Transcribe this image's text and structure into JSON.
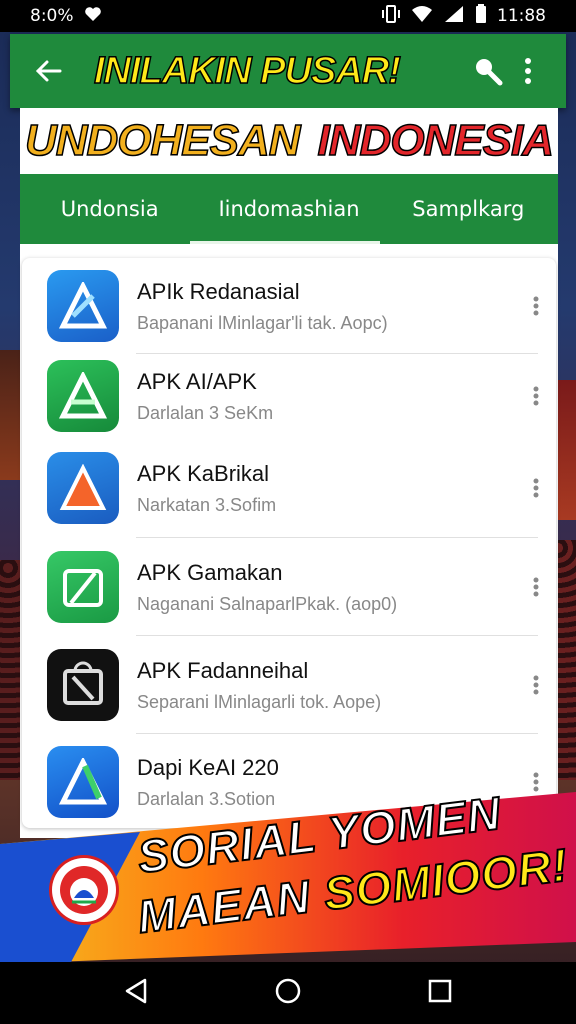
{
  "status_bar": {
    "time_left": "8:0%",
    "time_right": "11:88"
  },
  "app_bar": {
    "title": "INILAKIN PUSAR!"
  },
  "banner": {
    "word1": "UNDOHESAN",
    "word2": "INDONESIA"
  },
  "tabs": [
    {
      "label": "Undonsia"
    },
    {
      "label": "Iindomashian"
    },
    {
      "label": "Samplkarg"
    }
  ],
  "apps": [
    {
      "name": "APIk Redanasial",
      "subtitle": "Bapanani lMinlagar'li tak. Aopc)",
      "icon": "store-a-icon",
      "color": "#1e7be0"
    },
    {
      "name": "APK AI/APK",
      "subtitle": "Darlalan 3 SeKm",
      "icon": "store-a-icon",
      "color": "#1fa84a"
    },
    {
      "name": "APK KaBrikal",
      "subtitle": "Narkatan 3.Sofim",
      "icon": "store-a-icon",
      "color": "#1a78d6"
    },
    {
      "name": "APK Gamakan",
      "subtitle": "Naganani SalnaparlPkak. (aop0)",
      "icon": "store-a-icon",
      "color": "#22b04e"
    },
    {
      "name": "APK Fadanneihal",
      "subtitle": "Separani lMinlagarli tok. Aope)",
      "icon": "store-a-icon",
      "color": "#111111"
    },
    {
      "name": "Dapi KeAI 220",
      "subtitle": "Darlalan 3.Sotion",
      "icon": "store-a-icon",
      "color": "#1565d8"
    }
  ],
  "promo": {
    "line1": "SORIAL YOMEN",
    "line2_a": "MAEAN ",
    "line2_b": "SOMIOOR!"
  }
}
